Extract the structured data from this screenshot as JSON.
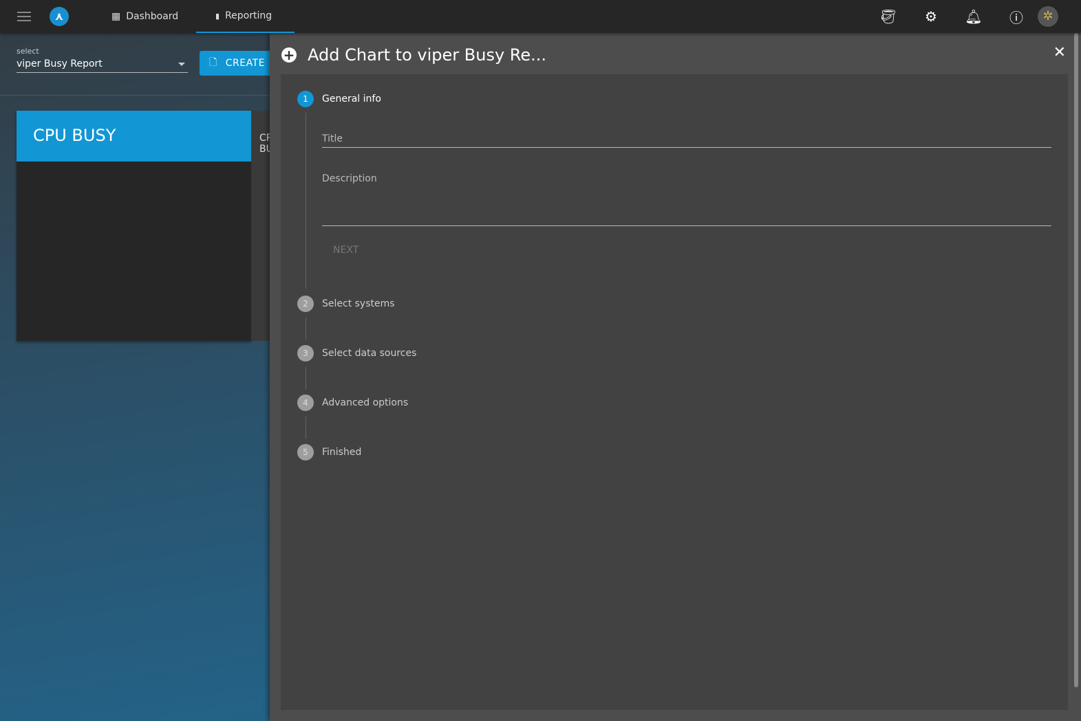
{
  "topbar": {
    "tabs": [
      {
        "label": "Dashboard",
        "icon": "dashboard-icon"
      },
      {
        "label": "Reporting",
        "icon": "bar-chart-icon"
      }
    ],
    "icons": [
      "paint-bucket-icon",
      "gear-icon",
      "bell-alert-icon",
      "help-icon",
      "avatar"
    ]
  },
  "report_select": {
    "label": "select",
    "value": "viper Busy Report"
  },
  "create_label": "CREATE",
  "card": {
    "title": "CPU BUSY",
    "next_title": "CPU BUSY"
  },
  "panel": {
    "title": "Add Chart to viper Busy Re...",
    "steps": [
      {
        "n": "1",
        "label": "General info",
        "active": true
      },
      {
        "n": "2",
        "label": "Select systems"
      },
      {
        "n": "3",
        "label": "Select data sources"
      },
      {
        "n": "4",
        "label": "Advanced options"
      },
      {
        "n": "5",
        "label": "Finished"
      }
    ],
    "title_placeholder": "Title",
    "description_placeholder": "Description",
    "next_label": "NEXT"
  },
  "colors": {
    "accent": "#1296d4",
    "topbar": "#262626",
    "panel": "#4d4d4d"
  }
}
